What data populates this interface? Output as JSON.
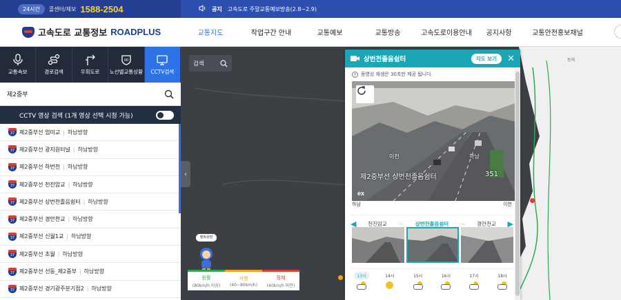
{
  "topbar": {
    "badge": "24시간",
    "callcenter": "콜센터/제보",
    "phone": "1588-2504",
    "notice_tag": "공지",
    "notice_text": "고속도로 주말교통예보방송(2.8~2.9)"
  },
  "header": {
    "logo_text": "고속도로 교통정보",
    "logo_brand": "ROADPLUS",
    "nav": [
      "교통지도",
      "작업구간 안내",
      "교통예보",
      "교통방송",
      "고속도로이용안내",
      "공지사항",
      "교통안전홍보채널"
    ],
    "active_nav": 0
  },
  "sidebar": {
    "tabs": [
      {
        "label": "교통속보",
        "icon": "microphone-icon"
      },
      {
        "label": "경로검색",
        "icon": "route-icon"
      },
      {
        "label": "우회도로",
        "icon": "detour-icon"
      },
      {
        "label": "노선별교통상황",
        "icon": "road-sign-icon"
      },
      {
        "label": "CCTV검색",
        "icon": "cctv-icon"
      }
    ],
    "active_tab": 4,
    "search_value": "제2중부",
    "cctv_bar": "CCTV 영상 검색 (1개 영상 선택 시청 가능)",
    "route_no": "37",
    "rows": [
      {
        "road": "제2중부선 엄미교",
        "dir": "하남방향"
      },
      {
        "road": "제2중부선 광지원터널",
        "dir": "하남방향"
      },
      {
        "road": "제2중부선 하번천",
        "dir": "하남방향"
      },
      {
        "road": "제2중부선 천진암교",
        "dir": "하남방향"
      },
      {
        "road": "제2중부선 상번천졸음쉼터",
        "dir": "하남방향"
      },
      {
        "road": "제2중부선 경안천교",
        "dir": "하남방향"
      },
      {
        "road": "제2중부선 신월1교",
        "dir": "하남방향"
      },
      {
        "road": "제2중부선 초월",
        "dir": "하남방향"
      },
      {
        "road": "제2중부선 선동_제2중부",
        "dir": "하남방향"
      },
      {
        "road": "제2중부선 경기광주분기점2",
        "dir": "하남방향"
      }
    ]
  },
  "map": {
    "search_label": "검색",
    "speech": "행복상담",
    "legend": [
      {
        "label": "원활",
        "sub": "(80km/h 이상)"
      },
      {
        "label": "서행",
        "sub": "(40~80km/h)"
      },
      {
        "label": "정체",
        "sub": "(40km/h 미만)"
      }
    ],
    "east_label": "동해"
  },
  "panel": {
    "title": "상번천졸음쉼터",
    "map_button": "지도 보기",
    "note": "동영상 재생은 30초만 제공 됩니다.",
    "video": {
      "caption_dir": "이천",
      "caption_road": "제2중부선",
      "caption_place": "상번천졸음쉼터",
      "caption_dest": "하남",
      "caption_num": "351",
      "logo": "ex"
    },
    "dir_left": "하남",
    "dir_right": "이천",
    "stations": [
      "천진암교",
      "상번천졸음쉼터",
      "경안천교"
    ],
    "current_station": 1,
    "weather": [
      {
        "time": "13시",
        "icon": "cloud-sun-icon"
      },
      {
        "time": "14시",
        "icon": "sun-icon"
      },
      {
        "time": "15시",
        "icon": "cloud-sun-icon"
      },
      {
        "time": "16시",
        "icon": "cloud-sun-icon"
      },
      {
        "time": "17시",
        "icon": "cloud-sun-icon"
      },
      {
        "time": "18시",
        "icon": "cloud-sun-icon"
      }
    ]
  },
  "colors": {
    "brand_blue": "#1f3c8e",
    "accent_blue": "#2d72e6",
    "teal": "#1ba5b5",
    "green": "#2fa84f",
    "orange": "#f3a21c",
    "red": "#e53a2d"
  }
}
